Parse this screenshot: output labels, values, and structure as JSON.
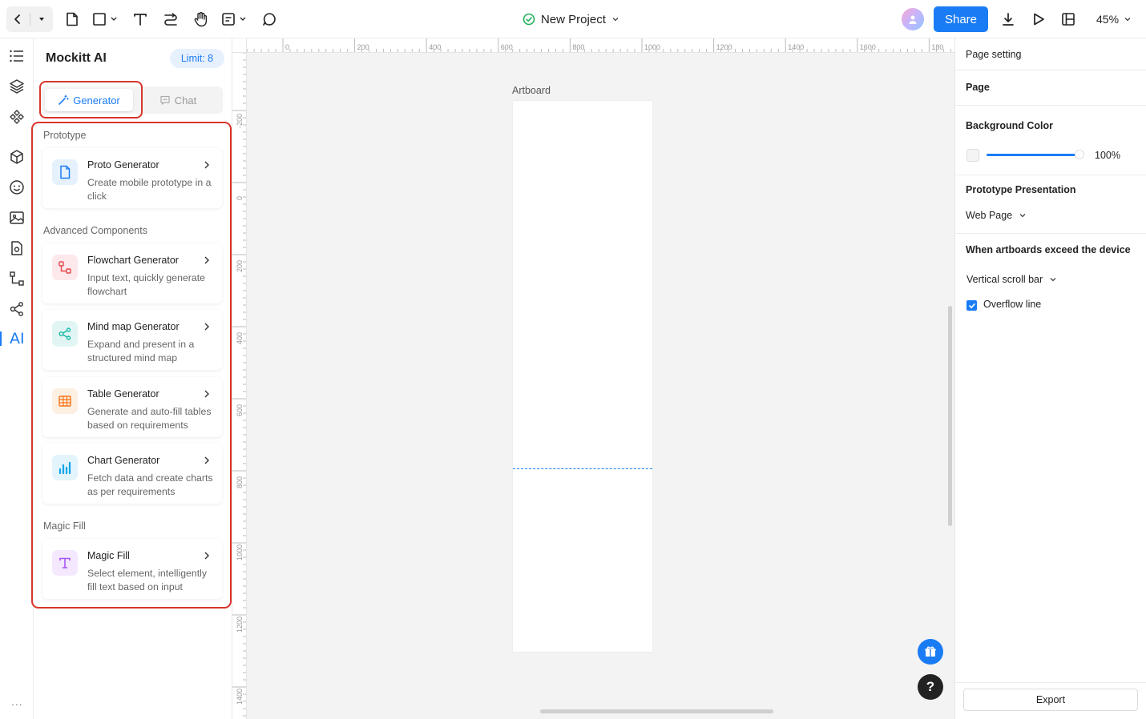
{
  "header": {
    "project_name": "New Project",
    "share_label": "Share",
    "zoom": "45%"
  },
  "ai_panel": {
    "title": "Mockitt AI",
    "limit": "Limit: 8",
    "tabs": {
      "generator": "Generator",
      "chat": "Chat"
    },
    "sections": {
      "prototype": "Prototype",
      "advanced": "Advanced Components",
      "magic": "Magic Fill"
    },
    "cards": [
      {
        "title": "Proto Generator",
        "desc": "Create mobile prototype in a click"
      },
      {
        "title": "Flowchart Generator",
        "desc": "Input text, quickly generate flowchart"
      },
      {
        "title": "Mind map Generator",
        "desc": "Expand and present in a structured mind map"
      },
      {
        "title": "Table Generator",
        "desc": "Generate and auto-fill tables based on requirements"
      },
      {
        "title": "Chart Generator",
        "desc": "Fetch data and create charts as per requirements"
      },
      {
        "title": "Magic Fill",
        "desc": "Select element, intelligently fill text based on input"
      }
    ]
  },
  "rail": {
    "ai_label": "AI",
    "more": "..."
  },
  "canvas": {
    "artboard_label": "Artboard",
    "ruler_h": [
      "0",
      "200",
      "400",
      "600",
      "800",
      "1000",
      "1200",
      "1400",
      "1600",
      "180"
    ],
    "ruler_v": [
      "-200",
      "0",
      "200",
      "400",
      "600",
      "800",
      "1000",
      "1200",
      "1400"
    ],
    "help": "?"
  },
  "right_panel": {
    "page_setting": "Page setting",
    "page": "Page",
    "bg_color": "Background Color",
    "bg_opacity": "100%",
    "presentation": "Prototype Presentation",
    "presentation_value": "Web Page",
    "exceed": "When artboards exceed the device",
    "scroll_value": "Vertical scroll bar",
    "overflow_line": "Overflow line",
    "export": "Export"
  },
  "colors": {
    "accent": "#1a7cf5",
    "highlight": "#d9352a"
  }
}
